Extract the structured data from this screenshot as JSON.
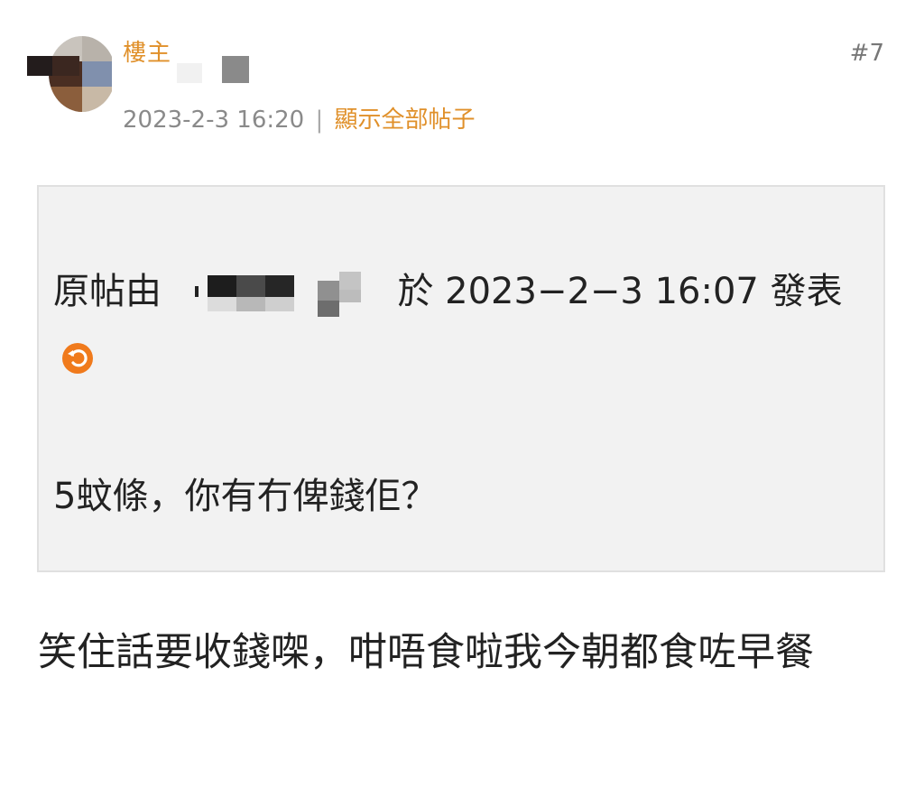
{
  "post": {
    "username": "樓主",
    "post_number": "#7",
    "timestamp": "2023-2-3 16:20",
    "separator": "|",
    "show_all_posts": "顯示全部帖子"
  },
  "quote": {
    "prefix": "原帖由",
    "posted_at_text": "於 2023−2−3 16:07 發表",
    "body": "5蚊條，你有冇俾錢佢？"
  },
  "reply": {
    "text": "笑住話要收錢㗎，咁唔食啦我今朝都食咗早餐"
  },
  "colors": {
    "accent": "#e0902a",
    "revert_icon": "#f07a1c",
    "quote_bg": "#f2f2f2"
  },
  "icons": {
    "revert": "circular-arrow-icon"
  }
}
